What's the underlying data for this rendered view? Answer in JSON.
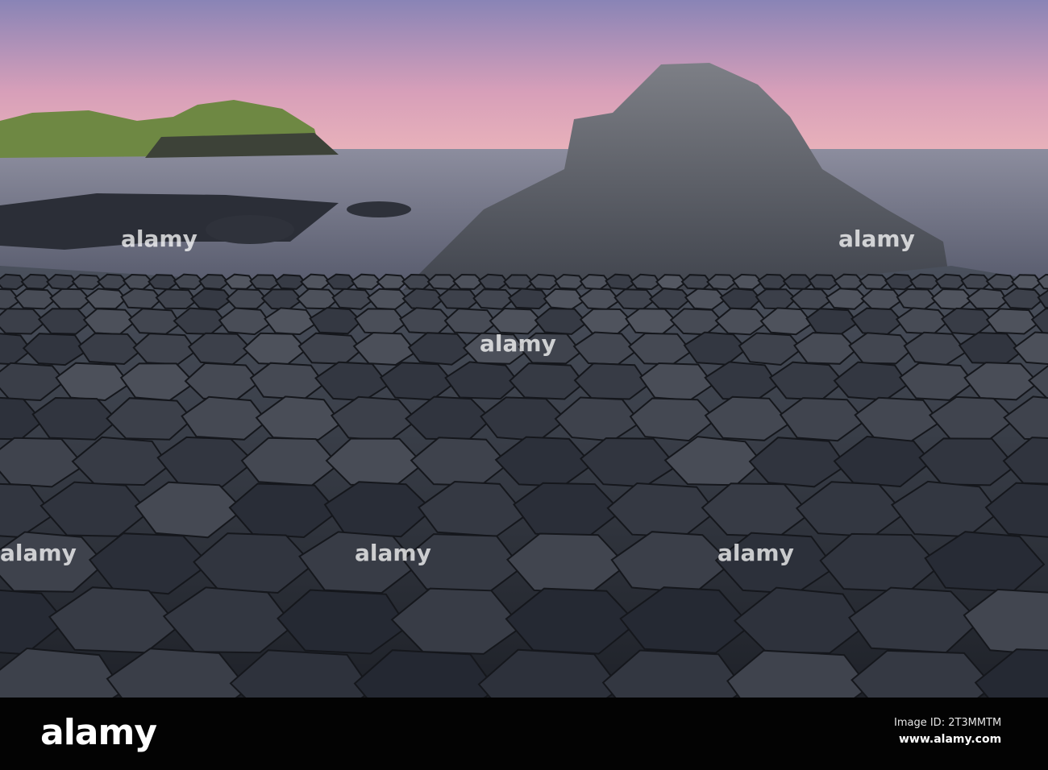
{
  "watermark": {
    "text": "alamy"
  },
  "footer": {
    "logo": "alamy",
    "image_id": "Image ID: 2T3MMTM",
    "url": "www.alamy.com"
  },
  "colors": {
    "sky_top": "#8c86b4",
    "sky_pink": "#e6a4b4",
    "sea": "#6d6f80",
    "rock": "#3a3f4a",
    "headland": "#6f8a45"
  }
}
